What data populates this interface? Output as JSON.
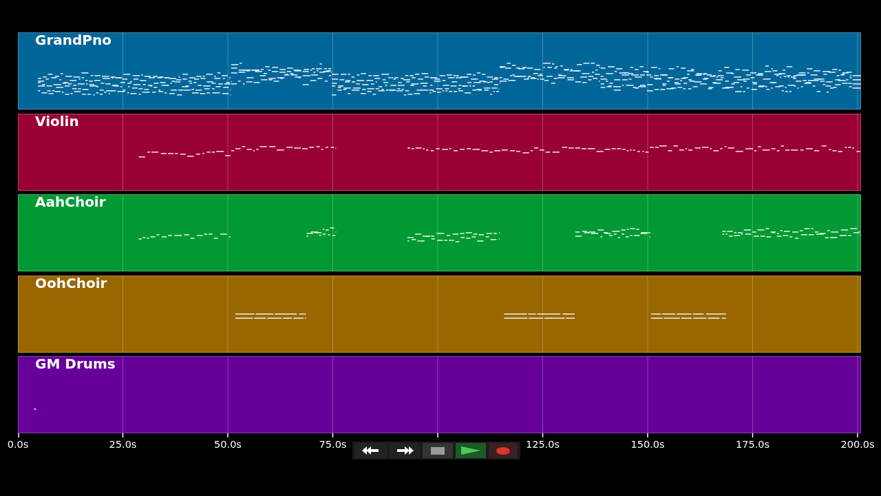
{
  "tracks": [
    {
      "name": "GrandPno",
      "color": "#006699"
    },
    {
      "name": "Violin",
      "color": "#990033"
    },
    {
      "name": "AahChoir",
      "color": "#009933"
    },
    {
      "name": "OohChoir",
      "color": "#996600"
    },
    {
      "name": "GM Drums",
      "color": "#660099"
    }
  ],
  "time_axis": {
    "ticks": [
      {
        "label": "0.0s"
      },
      {
        "label": "25.0s"
      },
      {
        "label": "50.0s"
      },
      {
        "label": "75.0s"
      },
      {
        "label": "125.0s"
      },
      {
        "label": "150.0s"
      },
      {
        "label": "175.0s"
      },
      {
        "label": "200.0s"
      }
    ]
  },
  "transport": [
    {
      "kind": "rewind"
    },
    {
      "kind": "forward"
    },
    {
      "kind": "stop"
    },
    {
      "kind": "play"
    },
    {
      "kind": "record"
    }
  ]
}
